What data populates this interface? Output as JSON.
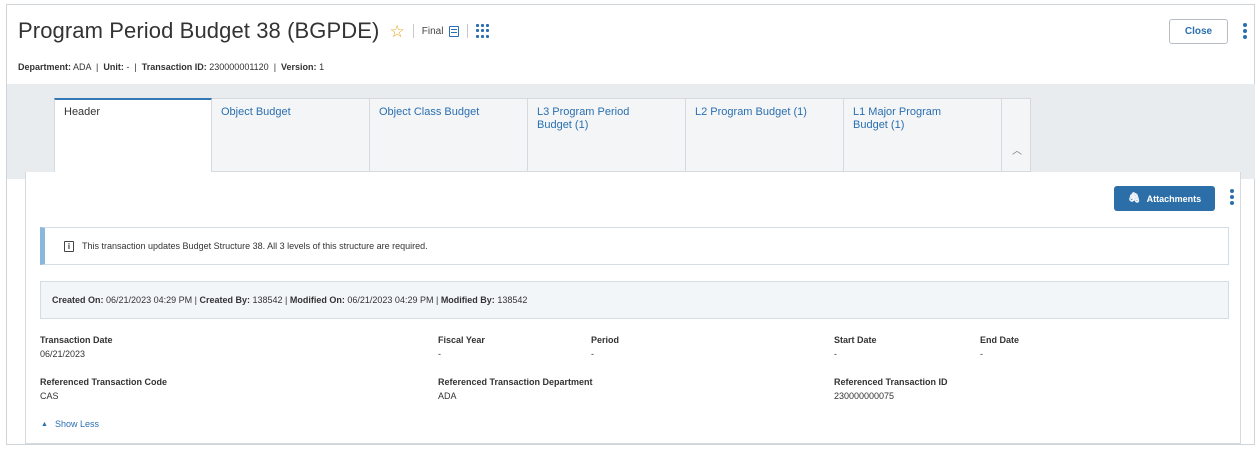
{
  "header": {
    "title": "Program Period Budget 38 (BGPDE)",
    "star_icon": "star-outline-icon",
    "status": "Final",
    "close_label": "Close"
  },
  "meta": {
    "department_label": "Department:",
    "department": "ADA",
    "unit_label": "Unit:",
    "unit": "-",
    "transaction_id_label": "Transaction ID:",
    "transaction_id": "230000001120",
    "version_label": "Version:",
    "version": "1"
  },
  "tabs": [
    {
      "label": "Header"
    },
    {
      "label": "Object Budget"
    },
    {
      "label": "Object Class Budget"
    },
    {
      "label": "L3 Program Period Budget (1)"
    },
    {
      "label": "L2 Program Budget (1)"
    },
    {
      "label": "L1 Major Program Budget (1)"
    }
  ],
  "toolbar": {
    "attachments_label": "Attachments"
  },
  "info_message": "This transaction updates Budget Structure 38. All 3 levels of this structure are required.",
  "audit": {
    "created_on_label": "Created On:",
    "created_on": "06/21/2023 04:29 PM",
    "created_by_label": "Created By:",
    "created_by": "138542",
    "modified_on_label": "Modified On:",
    "modified_on": "06/21/2023 04:29 PM",
    "modified_by_label": "Modified By:",
    "modified_by": "138542"
  },
  "fields": {
    "transaction_date": {
      "label": "Transaction Date",
      "value": "06/21/2023"
    },
    "fiscal_year": {
      "label": "Fiscal Year",
      "value": "-"
    },
    "period": {
      "label": "Period",
      "value": "-"
    },
    "start_date": {
      "label": "Start Date",
      "value": "-"
    },
    "end_date": {
      "label": "End Date",
      "value": "-"
    },
    "ref_code": {
      "label": "Referenced Transaction Code",
      "value": "CAS"
    },
    "ref_dept": {
      "label": "Referenced Transaction Department",
      "value": "ADA"
    },
    "ref_id": {
      "label": "Referenced Transaction ID",
      "value": "230000000075"
    }
  },
  "show_less_label": "Show Less",
  "colors": {
    "accent": "#2a6fb0",
    "button": "#2b6ea8",
    "star": "#e8a21a"
  }
}
